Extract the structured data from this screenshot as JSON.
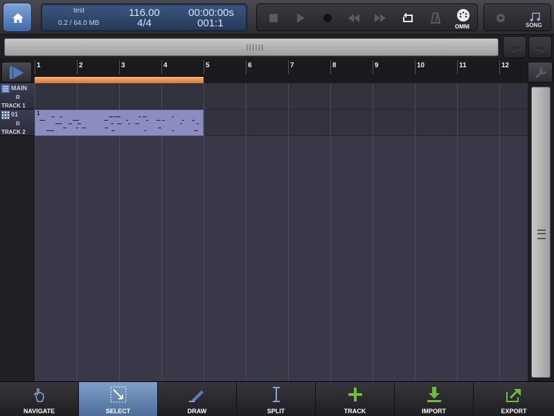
{
  "toolbar_top": {
    "song_name": "test",
    "memory": "0.2 / 64.0 MB",
    "tempo": "116.00",
    "time_signature": "4/4",
    "time": "00:00:00s",
    "position": "001:1",
    "omni_label": "OMNI",
    "song_label": "SONG"
  },
  "ruler": {
    "bars": [
      "1",
      "2",
      "3",
      "4",
      "5",
      "6",
      "7",
      "8",
      "9",
      "10",
      "11",
      "12"
    ]
  },
  "tracks": [
    {
      "name": "MAIN",
      "record": "R",
      "label": "TRACK 1",
      "type": "audio"
    },
    {
      "name": "01",
      "record": "R",
      "label": "TRACK 2",
      "type": "midi"
    }
  ],
  "clip": {
    "number": "1"
  },
  "bottom_tools": [
    {
      "label": "NAVIGATE",
      "icon": "hand-icon",
      "active": false
    },
    {
      "label": "SELECT",
      "icon": "select-icon",
      "active": true
    },
    {
      "label": "DRAW",
      "icon": "pencil-icon",
      "active": false
    },
    {
      "label": "SPLIT",
      "icon": "split-icon",
      "active": false
    },
    {
      "label": "TRACK",
      "icon": "plus-icon",
      "active": false
    },
    {
      "label": "IMPORT",
      "icon": "import-icon",
      "active": false
    },
    {
      "label": "EXPORT",
      "icon": "export-icon",
      "active": false
    }
  ],
  "colors": {
    "accent": "#4c6c98",
    "loop": "#e08a48",
    "clip": "#8c8cc0",
    "green_icon": "#6fbf3a"
  }
}
